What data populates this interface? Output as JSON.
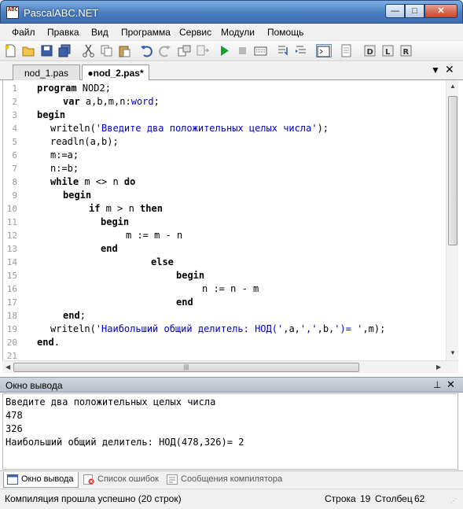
{
  "window": {
    "title": "PascalABC.NET",
    "icon_text": "ABC"
  },
  "menu": [
    "Файл",
    "Правка",
    "Вид",
    "Программа",
    "Сервис",
    "Модули",
    "Помощь"
  ],
  "tabs": [
    {
      "label": "nod_1.pas"
    },
    {
      "label": "●nod_2.pas*"
    }
  ],
  "code_lines": [
    "1",
    "2",
    "3",
    "4",
    "5",
    "6",
    "7",
    "8",
    "9",
    "10",
    "11",
    "12",
    "13",
    "14",
    "15",
    "16",
    "17",
    "18",
    "19",
    "20",
    "21"
  ],
  "code": {
    "l1a": "program",
    "l1b": " NOD2;",
    "l2a": "var",
    "l2b": " a,b,m,n:",
    "l2c": "word",
    "l2d": ";",
    "l3": "begin",
    "l4a": "writeln(",
    "l4b": "'Введите два положительных целых числа'",
    "l4c": ");",
    "l5": "readln(a,b);",
    "l6": "m:=a;",
    "l7": "n:=b;",
    "l8a": "while",
    "l8b": " m <> n ",
    "l8c": "do",
    "l9": "begin",
    "l10a": "if",
    "l10b": " m > n ",
    "l10c": "then",
    "l11": "begin",
    "l12": "m := m - n",
    "l13": "end",
    "l14": "else",
    "l15": "begin",
    "l16": "n := n - m",
    "l17": "end",
    "l18a": "end",
    "l18b": ";",
    "l19a": "writeln(",
    "l19b": "'Наибольший общий делитель: НОД('",
    "l19c": ",a,",
    "l19d": "','",
    "l19e": ",b,",
    "l19f": "')= '",
    "l19g": ",m);",
    "l20a": "end",
    "l20b": "."
  },
  "output_panel": {
    "title": "Окно вывода",
    "lines": [
      "Введите два положительных целых числа",
      "478",
      "326",
      "Наибольший общий делитель: НОД(478,326)= 2"
    ]
  },
  "bottom_tabs": [
    "Окно вывода",
    "Список ошибок",
    "Сообщения компилятора"
  ],
  "status": {
    "message": "Компиляция прошла успешно (20 строк)",
    "row_label": "Строка",
    "row_value": "19",
    "col_label": "Столбец",
    "col_value": "62"
  },
  "colors": {
    "keyword": "#000000",
    "string": "#0000c8",
    "titlebar": "#4a7fc0"
  }
}
